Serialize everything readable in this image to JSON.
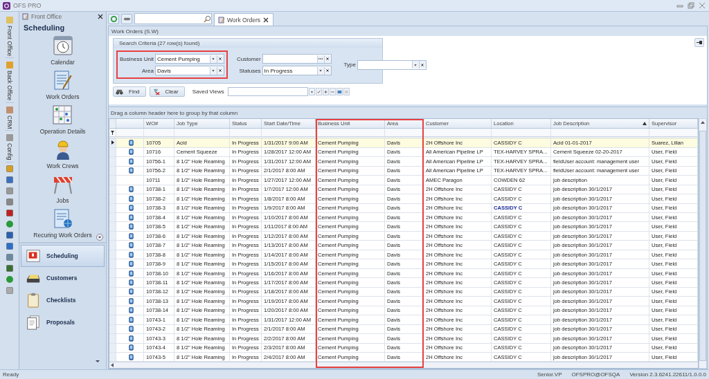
{
  "window": {
    "title": "OFS PRO"
  },
  "nav_strip": {
    "sections": [
      {
        "label": "Front Office"
      },
      {
        "label": "Back Office"
      },
      {
        "label": "CRM"
      },
      {
        "label": "Config"
      }
    ]
  },
  "sidebar": {
    "header": "Front Office",
    "title": "Scheduling",
    "items": [
      {
        "label": "Calendar",
        "kind": "calendar"
      },
      {
        "label": "Work Orders",
        "kind": "orders"
      },
      {
        "label": "Operation Details",
        "kind": "board"
      },
      {
        "label": "Work Crews",
        "kind": "crew"
      },
      {
        "label": "Jobs",
        "kind": "barrier"
      },
      {
        "label": "Recuring Work Orders",
        "kind": "recurring"
      }
    ],
    "modules": [
      {
        "label": "Scheduling",
        "kind": "calendar",
        "selected": true
      },
      {
        "label": "Customers",
        "kind": "box",
        "selected": false
      },
      {
        "label": "Checklists",
        "kind": "clipboard",
        "selected": false
      },
      {
        "label": "Proposals",
        "kind": "papers",
        "selected": false
      }
    ]
  },
  "tabs": [
    {
      "label": "Work Orders",
      "selected": true
    }
  ],
  "panel_title": "Work Orders (S.W)",
  "search_criteria": {
    "title": "Search Criteria (27 row(s) found)",
    "groups": [
      {
        "highlighted": true,
        "fields": [
          {
            "label": "Business Unit",
            "value": "Cement Pumping",
            "kind": "dropdown"
          },
          {
            "label": "Area",
            "value": "Davis",
            "kind": "dropdown"
          }
        ]
      },
      {
        "highlighted": false,
        "fields": [
          {
            "label": "Customer",
            "kind": "lookup"
          },
          {
            "label": "Statuses",
            "value": "In Progress",
            "kind": "dropdown"
          }
        ]
      },
      {
        "highlighted": false,
        "fields": [
          {
            "label": "Type",
            "kind": "dropdown"
          }
        ]
      }
    ]
  },
  "actions": [
    {
      "label": "Find",
      "kind": "find"
    },
    {
      "label": "Clear",
      "kind": "clear"
    }
  ],
  "saved_views": {
    "label": "Saved Views"
  },
  "grid": {
    "group_hint": "Drag a column header here to group by that column",
    "columns": [
      {
        "label": "WO#",
        "highlighted": false,
        "sorted": false
      },
      {
        "label": "Job Type",
        "highlighted": false,
        "sorted": false
      },
      {
        "label": "Status",
        "highlighted": false,
        "sorted": false
      },
      {
        "label": "Start Date/Time",
        "highlighted": false,
        "sorted": false
      },
      {
        "label": "Business Unit",
        "highlighted": true,
        "sorted": false
      },
      {
        "label": "Area",
        "highlighted": true,
        "sorted": false
      },
      {
        "label": "Customer",
        "highlighted": false,
        "sorted": false
      },
      {
        "label": "Location",
        "highlighted": false,
        "sorted": false
      },
      {
        "label": "Job Description",
        "highlighted": false,
        "sorted": true
      },
      {
        "label": "Supervisor",
        "highlighted": false,
        "sorted": false
      }
    ],
    "rows": [
      {
        "selected": true,
        "mobile": true,
        "location_link": false,
        "cells": [
          "10705",
          "Acid",
          "In Progress",
          "1/31/2017 9:00 AM",
          "Cement Pumping",
          "Davis",
          "2H Offshore Inc",
          "CASSIDY C",
          "Acid 01-01-2017",
          "Suarez, Lilian"
        ]
      },
      {
        "selected": false,
        "mobile": true,
        "location_link": false,
        "cells": [
          "10716",
          "Cement Squeeze",
          "In Progress",
          "1/28/2017 12:00 AM",
          "Cement Pumping",
          "Davis",
          "All American Pipeline LP",
          "TEX-HARVEY SPRA...",
          "Cement Squeeze 02-20-2017",
          "User, Field"
        ]
      },
      {
        "selected": false,
        "mobile": true,
        "location_link": false,
        "cells": [
          "10756-1",
          "8 1/2\" Hole Reaming",
          "In Progress",
          "1/31/2017 12:00 AM",
          "Cement Pumping",
          "Davis",
          "All American Pipeline LP",
          "TEX-HARVEY SPRA...",
          "fieldUser account: management user",
          "User, Field"
        ]
      },
      {
        "selected": false,
        "mobile": true,
        "location_link": false,
        "cells": [
          "10756-2",
          "8 1/2\" Hole Reaming",
          "In Progress",
          "2/1/2017 8:00 AM",
          "Cement Pumping",
          "Davis",
          "All American Pipeline LP",
          "TEX-HARVEY SPRA...",
          "fieldUser account: management user",
          "User, Field"
        ]
      },
      {
        "selected": false,
        "mobile": false,
        "location_link": false,
        "cells": [
          "10711",
          "8 1/2\" Hole Reaming",
          "In Progress",
          "1/27/2017 12:00 AM",
          "Cement Pumping",
          "Davis",
          "AMEC Paragon",
          "COWDEN 62",
          "job description",
          "User, Field"
        ]
      },
      {
        "selected": false,
        "mobile": true,
        "location_link": false,
        "cells": [
          "10738-1",
          "8 1/2\" Hole Reaming",
          "In Progress",
          "1/7/2017 12:00 AM",
          "Cement Pumping",
          "Davis",
          "2H Offshore Inc",
          "CASSIDY C",
          "job description 30/1/2017",
          "User, Field"
        ]
      },
      {
        "selected": false,
        "mobile": true,
        "location_link": false,
        "cells": [
          "10738-2",
          "8 1/2\" Hole Reaming",
          "In Progress",
          "1/8/2017 8:00 AM",
          "Cement Pumping",
          "Davis",
          "2H Offshore Inc",
          "CASSIDY C",
          "job description 30/1/2017",
          "User, Field"
        ]
      },
      {
        "selected": false,
        "mobile": true,
        "location_link": true,
        "cells": [
          "10738-3",
          "8 1/2\" Hole Reaming",
          "In Progress",
          "1/9/2017 8:00 AM",
          "Cement Pumping",
          "Davis",
          "2H Offshore Inc",
          "CASSIDY C",
          "job description 30/1/2017",
          "User, Field"
        ]
      },
      {
        "selected": false,
        "mobile": true,
        "location_link": false,
        "cells": [
          "10738-4",
          "8 1/2\" Hole Reaming",
          "In Progress",
          "1/10/2017 8:00 AM",
          "Cement Pumping",
          "Davis",
          "2H Offshore Inc",
          "CASSIDY C",
          "job description 30/1/2017",
          "User, Field"
        ]
      },
      {
        "selected": false,
        "mobile": true,
        "location_link": false,
        "cells": [
          "10738-5",
          "8 1/2\" Hole Reaming",
          "In Progress",
          "1/11/2017 8:00 AM",
          "Cement Pumping",
          "Davis",
          "2H Offshore Inc",
          "CASSIDY C",
          "job description 30/1/2017",
          "User, Field"
        ]
      },
      {
        "selected": false,
        "mobile": true,
        "location_link": false,
        "cells": [
          "10738-6",
          "8 1/2\" Hole Reaming",
          "In Progress",
          "1/12/2017 8:00 AM",
          "Cement Pumping",
          "Davis",
          "2H Offshore Inc",
          "CASSIDY C",
          "job description 30/1/2017",
          "User, Field"
        ]
      },
      {
        "selected": false,
        "mobile": true,
        "location_link": false,
        "cells": [
          "10738-7",
          "8 1/2\" Hole Reaming",
          "In Progress",
          "1/13/2017 8:00 AM",
          "Cement Pumping",
          "Davis",
          "2H Offshore Inc",
          "CASSIDY C",
          "job description 30/1/2017",
          "User, Field"
        ]
      },
      {
        "selected": false,
        "mobile": true,
        "location_link": false,
        "cells": [
          "10738-8",
          "8 1/2\" Hole Reaming",
          "In Progress",
          "1/14/2017 8:00 AM",
          "Cement Pumping",
          "Davis",
          "2H Offshore Inc",
          "CASSIDY C",
          "job description 30/1/2017",
          "User, Field"
        ]
      },
      {
        "selected": false,
        "mobile": true,
        "location_link": false,
        "cells": [
          "10738-9",
          "8 1/2\" Hole Reaming",
          "In Progress",
          "1/15/2017 8:00 AM",
          "Cement Pumping",
          "Davis",
          "2H Offshore Inc",
          "CASSIDY C",
          "job description 30/1/2017",
          "User, Field"
        ]
      },
      {
        "selected": false,
        "mobile": true,
        "location_link": false,
        "cells": [
          "10738-10",
          "8 1/2\" Hole Reaming",
          "In Progress",
          "1/16/2017 8:00 AM",
          "Cement Pumping",
          "Davis",
          "2H Offshore Inc",
          "CASSIDY C",
          "job description 30/1/2017",
          "User, Field"
        ]
      },
      {
        "selected": false,
        "mobile": true,
        "location_link": false,
        "cells": [
          "10738-11",
          "8 1/2\" Hole Reaming",
          "In Progress",
          "1/17/2017 8:00 AM",
          "Cement Pumping",
          "Davis",
          "2H Offshore Inc",
          "CASSIDY C",
          "job description 30/1/2017",
          "User, Field"
        ]
      },
      {
        "selected": false,
        "mobile": true,
        "location_link": false,
        "cells": [
          "10738-12",
          "8 1/2\" Hole Reaming",
          "In Progress",
          "1/18/2017 8:00 AM",
          "Cement Pumping",
          "Davis",
          "2H Offshore Inc",
          "CASSIDY C",
          "job description 30/1/2017",
          "User, Field"
        ]
      },
      {
        "selected": false,
        "mobile": true,
        "location_link": false,
        "cells": [
          "10738-13",
          "8 1/2\" Hole Reaming",
          "In Progress",
          "1/19/2017 8:00 AM",
          "Cement Pumping",
          "Davis",
          "2H Offshore Inc",
          "CASSIDY C",
          "job description 30/1/2017",
          "User, Field"
        ]
      },
      {
        "selected": false,
        "mobile": true,
        "location_link": false,
        "cells": [
          "10738-14",
          "8 1/2\" Hole Reaming",
          "In Progress",
          "1/20/2017 8:00 AM",
          "Cement Pumping",
          "Davis",
          "2H Offshore Inc",
          "CASSIDY C",
          "job description 30/1/2017",
          "User, Field"
        ]
      },
      {
        "selected": false,
        "mobile": true,
        "location_link": false,
        "cells": [
          "10743-1",
          "8 1/2\" Hole Reaming",
          "In Progress",
          "1/31/2017 12:00 AM",
          "Cement Pumping",
          "Davis",
          "2H Offshore Inc",
          "CASSIDY C",
          "job description 30/1/2017",
          "User, Field"
        ]
      },
      {
        "selected": false,
        "mobile": true,
        "location_link": false,
        "cells": [
          "10743-2",
          "8 1/2\" Hole Reaming",
          "In Progress",
          "2/1/2017 8:00 AM",
          "Cement Pumping",
          "Davis",
          "2H Offshore Inc",
          "CASSIDY C",
          "job description 30/1/2017",
          "User, Field"
        ]
      },
      {
        "selected": false,
        "mobile": true,
        "location_link": false,
        "cells": [
          "10743-3",
          "8 1/2\" Hole Reaming",
          "In Progress",
          "2/2/2017 8:00 AM",
          "Cement Pumping",
          "Davis",
          "2H Offshore Inc",
          "CASSIDY C",
          "job description 30/1/2017",
          "User, Field"
        ]
      },
      {
        "selected": false,
        "mobile": true,
        "location_link": false,
        "cells": [
          "10743-4",
          "8 1/2\" Hole Reaming",
          "In Progress",
          "2/3/2017 8:00 AM",
          "Cement Pumping",
          "Davis",
          "2H Offshore Inc",
          "CASSIDY C",
          "job description 30/1/2017",
          "User, Field"
        ]
      },
      {
        "selected": false,
        "mobile": true,
        "location_link": false,
        "cells": [
          "10743-5",
          "8 1/2\" Hole Reaming",
          "In Progress",
          "2/4/2017 8:00 AM",
          "Cement Pumping",
          "Davis",
          "2H Offshore Inc",
          "CASSIDY C",
          "job description 30/1/2017",
          "User, Field"
        ]
      }
    ]
  },
  "status_bar": {
    "status": "Ready",
    "user": "Senior.VP",
    "connection": "OFSPRO@OFSQA",
    "version": "Version 2.3.6241.22611/1.0.0.0"
  }
}
